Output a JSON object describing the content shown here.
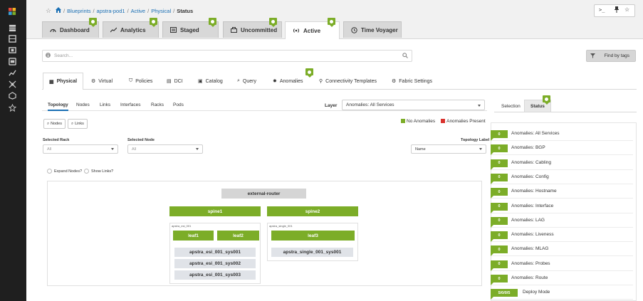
{
  "breadcrumb": {
    "items": [
      "Blueprints",
      "apstra-pod1",
      "Active",
      "Physical"
    ],
    "current": "Status",
    "sep": "/"
  },
  "main_tabs": [
    {
      "label": "Dashboard",
      "badge": true
    },
    {
      "label": "Analytics",
      "badge": true
    },
    {
      "label": "Staged",
      "badge": true
    },
    {
      "label": "Uncommitted",
      "badge": true
    },
    {
      "label": "Active",
      "badge": true
    },
    {
      "label": "Time Voyager",
      "badge": false
    }
  ],
  "search": {
    "placeholder": "Search...",
    "find_label": "Find by tags"
  },
  "sub_tabs": [
    "Physical",
    "Virtual",
    "Policies",
    "DCI",
    "Catalog",
    "Query",
    "Anomalies",
    "Connectivity Templates",
    "Fabric Settings"
  ],
  "topo_tabs": [
    "Topology",
    "Nodes",
    "Links",
    "Interfaces",
    "Racks",
    "Pods"
  ],
  "layer": {
    "label": "Layer",
    "value": "Anomalies: All Services"
  },
  "legend": {
    "no_anomalies": "No Anomalies",
    "anomalies_present": "Anomalies Present",
    "green": "#7cad28",
    "red": "#d9322e"
  },
  "buttons": {
    "nodes": "Nodes",
    "links": "Links"
  },
  "filters": {
    "selected_rack": {
      "label": "Selected Rack",
      "value": "All"
    },
    "selected_node": {
      "label": "Selected Node",
      "value": "All"
    },
    "topology_label": {
      "label": "Topology Label",
      "value": "Name"
    }
  },
  "checks": {
    "expand_nodes": "Expand Nodes?",
    "show_links": "Show Links?"
  },
  "topology": {
    "external": "external-router",
    "spine1": "spine1",
    "spine2": "spine2",
    "rack1_label": "apstra_esi_001",
    "rack2_label": "apstra_single_001",
    "leaf1": "leaf1",
    "leaf2": "leaf2",
    "leaf3": "leaf3",
    "sys1": "apstra_esi_001_sys001",
    "sys2": "apstra_esi_001_sys002",
    "sys3": "apstra_esi_001_sys003",
    "sys4": "apstra_single_001_sys001"
  },
  "side_tabs": {
    "selection": "Selection",
    "status": "Status"
  },
  "status_rows": [
    {
      "count": "0",
      "label": "Anomalies: All Services"
    },
    {
      "count": "0",
      "label": "Anomalies: BGP"
    },
    {
      "count": "0",
      "label": "Anomalies: Cabling"
    },
    {
      "count": "0",
      "label": "Anomalies: Config"
    },
    {
      "count": "0",
      "label": "Anomalies: Hostname"
    },
    {
      "count": "0",
      "label": "Anomalies: Interface"
    },
    {
      "count": "0",
      "label": "Anomalies: LAG"
    },
    {
      "count": "0",
      "label": "Anomalies: Liveness"
    },
    {
      "count": "0",
      "label": "Anomalies: MLAG"
    },
    {
      "count": "0",
      "label": "Anomalies: Probes"
    },
    {
      "count": "0",
      "label": "Anomalies: Route"
    },
    {
      "count": "5/0/0/5",
      "label": "Deploy Mode"
    }
  ]
}
